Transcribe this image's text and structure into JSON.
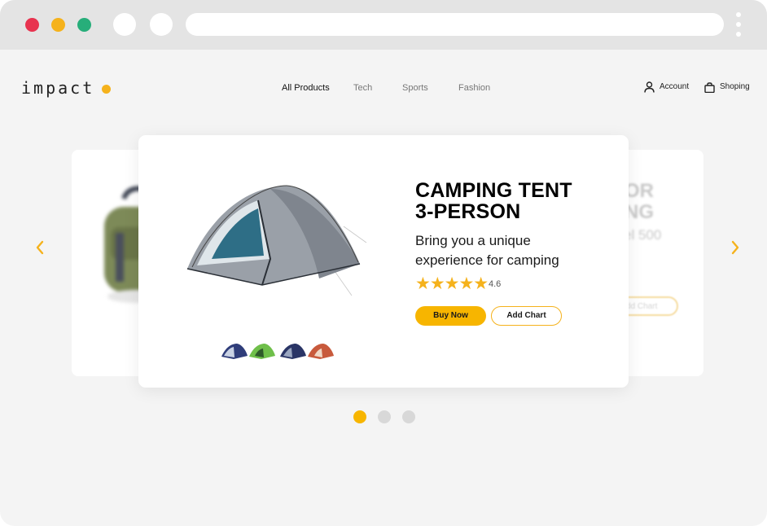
{
  "brand": {
    "logo_text": "impact",
    "accent": "#f5b21c"
  },
  "nav": {
    "items": [
      {
        "label": "All Products",
        "active": true
      },
      {
        "label": "Tech",
        "active": false
      },
      {
        "label": "Sports",
        "active": false
      },
      {
        "label": "Fashion",
        "active": false
      }
    ]
  },
  "header": {
    "account_label": "Account",
    "account_icon": "user-icon",
    "shopping_label": "Shoping",
    "shopping_icon": "shopping-bag-icon"
  },
  "carousel": {
    "current": {
      "title_line1": "CAMPING TENT",
      "title_line2": "3-PERSON",
      "description": "Bring you a unique experience for camping",
      "stars": "★★★★★",
      "rating": "4.6",
      "buy_label": "Buy Now",
      "add_label": "Add Chart",
      "thumbnail_colors": [
        "#2f3d7a",
        "#6fbf4a",
        "#2a3566",
        "#c85a3c"
      ]
    },
    "next_preview": {
      "title_line1": "OR",
      "title_line2": "NG",
      "subtitle": "el 500",
      "button_label": "dd Chart"
    },
    "page_count": 3,
    "active_index": 0
  },
  "colors": {
    "primary_button": "#f7b500",
    "traffic_red": "#e8334f",
    "traffic_yellow": "#f5b21c",
    "traffic_green": "#27ae7a"
  }
}
